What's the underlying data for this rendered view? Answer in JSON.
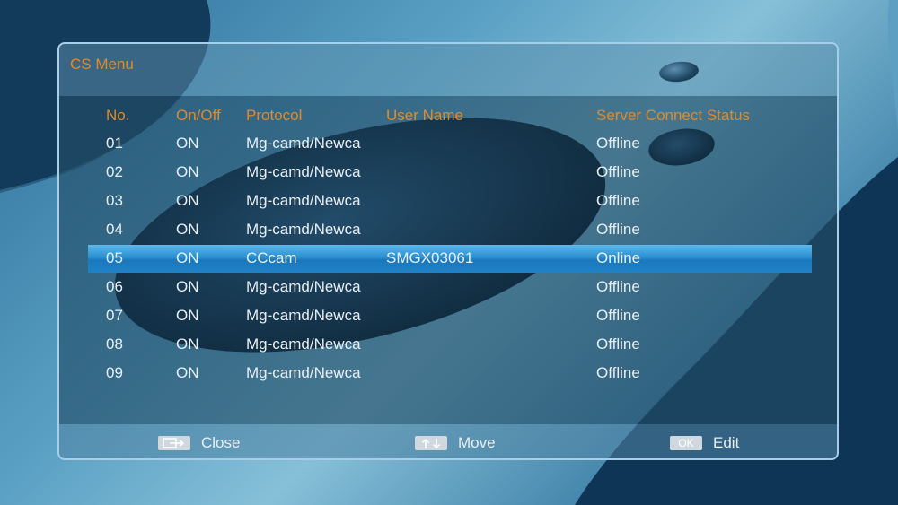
{
  "menu": {
    "title": "CS Menu"
  },
  "table": {
    "headers": {
      "no": "No.",
      "on_off": "On/Off",
      "protocol": "Protocol",
      "user_name": "User Name",
      "status": "Server Connect Status"
    },
    "selected_index": 4,
    "rows": [
      {
        "no": "01",
        "on_off": "ON",
        "protocol": "Mg-camd/Newca",
        "user_name": "",
        "status": "Offline"
      },
      {
        "no": "02",
        "on_off": "ON",
        "protocol": "Mg-camd/Newca",
        "user_name": "",
        "status": "Offline"
      },
      {
        "no": "03",
        "on_off": "ON",
        "protocol": "Mg-camd/Newca",
        "user_name": "",
        "status": "Offline"
      },
      {
        "no": "04",
        "on_off": "ON",
        "protocol": "Mg-camd/Newca",
        "user_name": "",
        "status": "Offline"
      },
      {
        "no": "05",
        "on_off": "ON",
        "protocol": "CCcam",
        "user_name": "SMGX03061",
        "status": "Online"
      },
      {
        "no": "06",
        "on_off": "ON",
        "protocol": "Mg-camd/Newca",
        "user_name": "",
        "status": "Offline"
      },
      {
        "no": "07",
        "on_off": "ON",
        "protocol": "Mg-camd/Newca",
        "user_name": "",
        "status": "Offline"
      },
      {
        "no": "08",
        "on_off": "ON",
        "protocol": "Mg-camd/Newca",
        "user_name": "",
        "status": "Offline"
      },
      {
        "no": "09",
        "on_off": "ON",
        "protocol": "Mg-camd/Newca",
        "user_name": "",
        "status": "Offline"
      }
    ]
  },
  "footer": {
    "close": {
      "label": "Close",
      "icon": "exit-key-icon"
    },
    "move": {
      "label": "Move",
      "icon": "arrow-keys-icon"
    },
    "edit": {
      "label": "Edit",
      "icon": "ok-key-icon",
      "key_text": "OK"
    }
  },
  "colors": {
    "header_text": "#e08a2a",
    "row_text": "#e8eef3",
    "selection": "#1f82c6"
  }
}
